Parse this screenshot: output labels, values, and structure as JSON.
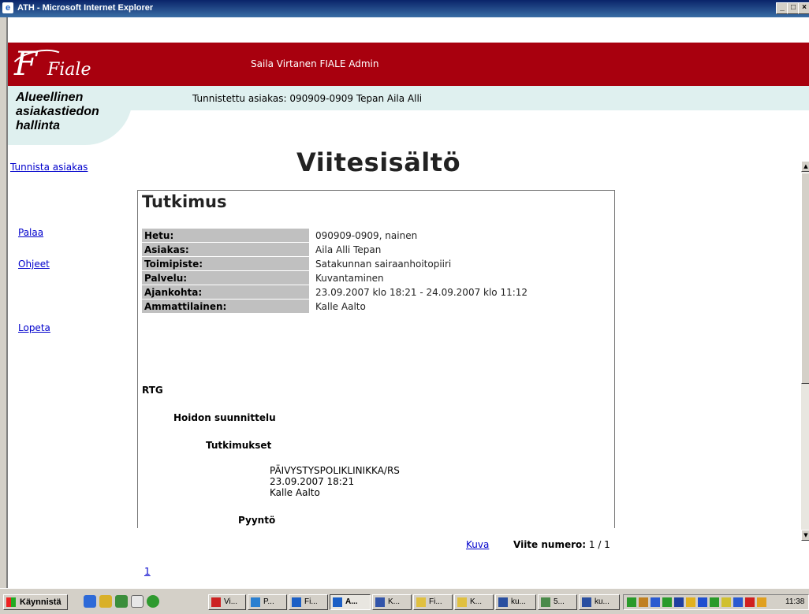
{
  "window": {
    "title": "ATH - Microsoft Internet Explorer",
    "min": "_",
    "max": "□",
    "close": "×"
  },
  "banner": {
    "logo": "Fiale",
    "logo_initial": "F",
    "user": "Saila Virtanen FIALE Admin"
  },
  "region": {
    "line1": "Alueellinen",
    "line2": "asiakastiedon",
    "line3": "hallinta"
  },
  "customer": {
    "text": "Tunnistettu asiakas: 090909-0909 Tepan Aila Alli"
  },
  "page_title": "Viitesisältö",
  "sidebar": {
    "identify": "Tunnista asiakas",
    "back": "Palaa",
    "help": "Ohjeet",
    "quit": "Lopeta"
  },
  "report": {
    "title": "Tutkimus",
    "rows": [
      {
        "label": "Hetu:",
        "value": "090909-0909, nainen"
      },
      {
        "label": "Asiakas:",
        "value": "Aila Alli Tepan"
      },
      {
        "label": "Toimipiste:",
        "value": "Satakunnan sairaanhoitopiiri"
      },
      {
        "label": "Palvelu:",
        "value": "Kuvantaminen"
      },
      {
        "label": "Ajankohta:",
        "value": "23.09.2007 klo 18:21 - 24.09.2007 klo 11:12"
      },
      {
        "label": "Ammattilainen:",
        "value": "Kalle Aalto"
      }
    ],
    "rtg": "RTG",
    "hoidon": "Hoidon suunnittelu",
    "tutkimukset": "Tutkimukset",
    "clinic": "PÄIVYSTYSPOLIKLINIKKA/RS",
    "datetime": "23.09.2007 18:21",
    "author": "Kalle Aalto",
    "pyynto": "Pyyntö"
  },
  "footer": {
    "kuva": "Kuva",
    "viite_label": "Viite numero:",
    "viite_value": "1 / 1",
    "page_link": "1"
  },
  "taskbar": {
    "start": "Käynnistä",
    "tasks": [
      "Vi...",
      "P...",
      "Fi...",
      "A...",
      "K...",
      "Fi...",
      "K...",
      "ku...",
      "5...",
      "ku..."
    ],
    "clock": "11:38"
  }
}
